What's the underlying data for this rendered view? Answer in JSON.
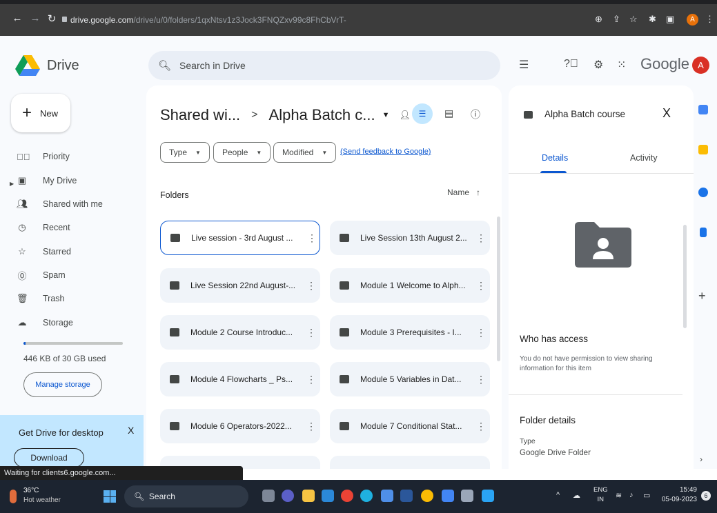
{
  "browser": {
    "url_host": "drive.google.com",
    "url_path": "/drive/u/0/folders/1qxNtsv1z3Jock3FNQZxv99c8FhCbVrT-",
    "profile_initial": "A"
  },
  "header": {
    "brand": "Drive",
    "search_placeholder": "Search in Drive",
    "google_word": "Google",
    "avatar_initial": "A"
  },
  "sidebar": {
    "new_label": "New",
    "items": [
      {
        "label": "Priority",
        "icon": "check-circle-icon"
      },
      {
        "label": "My Drive",
        "icon": "drive-icon"
      },
      {
        "label": "Shared with me",
        "icon": "people-icon"
      },
      {
        "label": "Recent",
        "icon": "clock-icon"
      },
      {
        "label": "Starred",
        "icon": "star-icon"
      },
      {
        "label": "Spam",
        "icon": "spam-icon"
      },
      {
        "label": "Trash",
        "icon": "trash-icon"
      },
      {
        "label": "Storage",
        "icon": "cloud-icon"
      }
    ],
    "storage_used_text": "446 KB of 30 GB used",
    "storage_fraction": 0.01,
    "manage_storage": "Manage storage",
    "promo": {
      "title": "Get Drive for desktop",
      "close": "X",
      "download": "Download"
    }
  },
  "main": {
    "breadcrumb": {
      "parent": "Shared wi...",
      "separator": ">",
      "current": "Alpha Batch c..."
    },
    "filters": {
      "type": "Type",
      "people": "People",
      "modified": "Modified",
      "feedback": "(Send feedback to Google)"
    },
    "folders_label": "Folders",
    "sort_label": "Name",
    "sort_arrow": "↑",
    "folders": [
      "Live session - 3rd August ...",
      "Live Session 13th August 2...",
      "Live Session 22nd August-...",
      "Module 1 Welcome to Alph...",
      "Module 2 Course Introduc...",
      "Module 3 Prerequisites - I...",
      "Module 4 Flowcharts _ Ps...",
      "Module 5 Variables in Dat...",
      "Module 6 Operators-2022...",
      "Module 7 Conditional Stat..."
    ]
  },
  "details_panel": {
    "title": "Alpha Batch course",
    "close": "X",
    "tabs": [
      "Details",
      "Activity"
    ],
    "who_has_access": "Who has access",
    "who_has_access_sub": "You do not have permission to view sharing information for this item",
    "folder_details": "Folder details",
    "type_label": "Type",
    "type_value": "Google Drive Folder"
  },
  "status_bar": "Waiting for clients6.google.com...",
  "taskbar": {
    "temp": "36°C",
    "weather": "Hot weather",
    "search": "Search",
    "lang_top": "ENG",
    "lang_bottom": "IN",
    "time": "15:49",
    "date": "05-09-2023",
    "notifications": "6"
  }
}
